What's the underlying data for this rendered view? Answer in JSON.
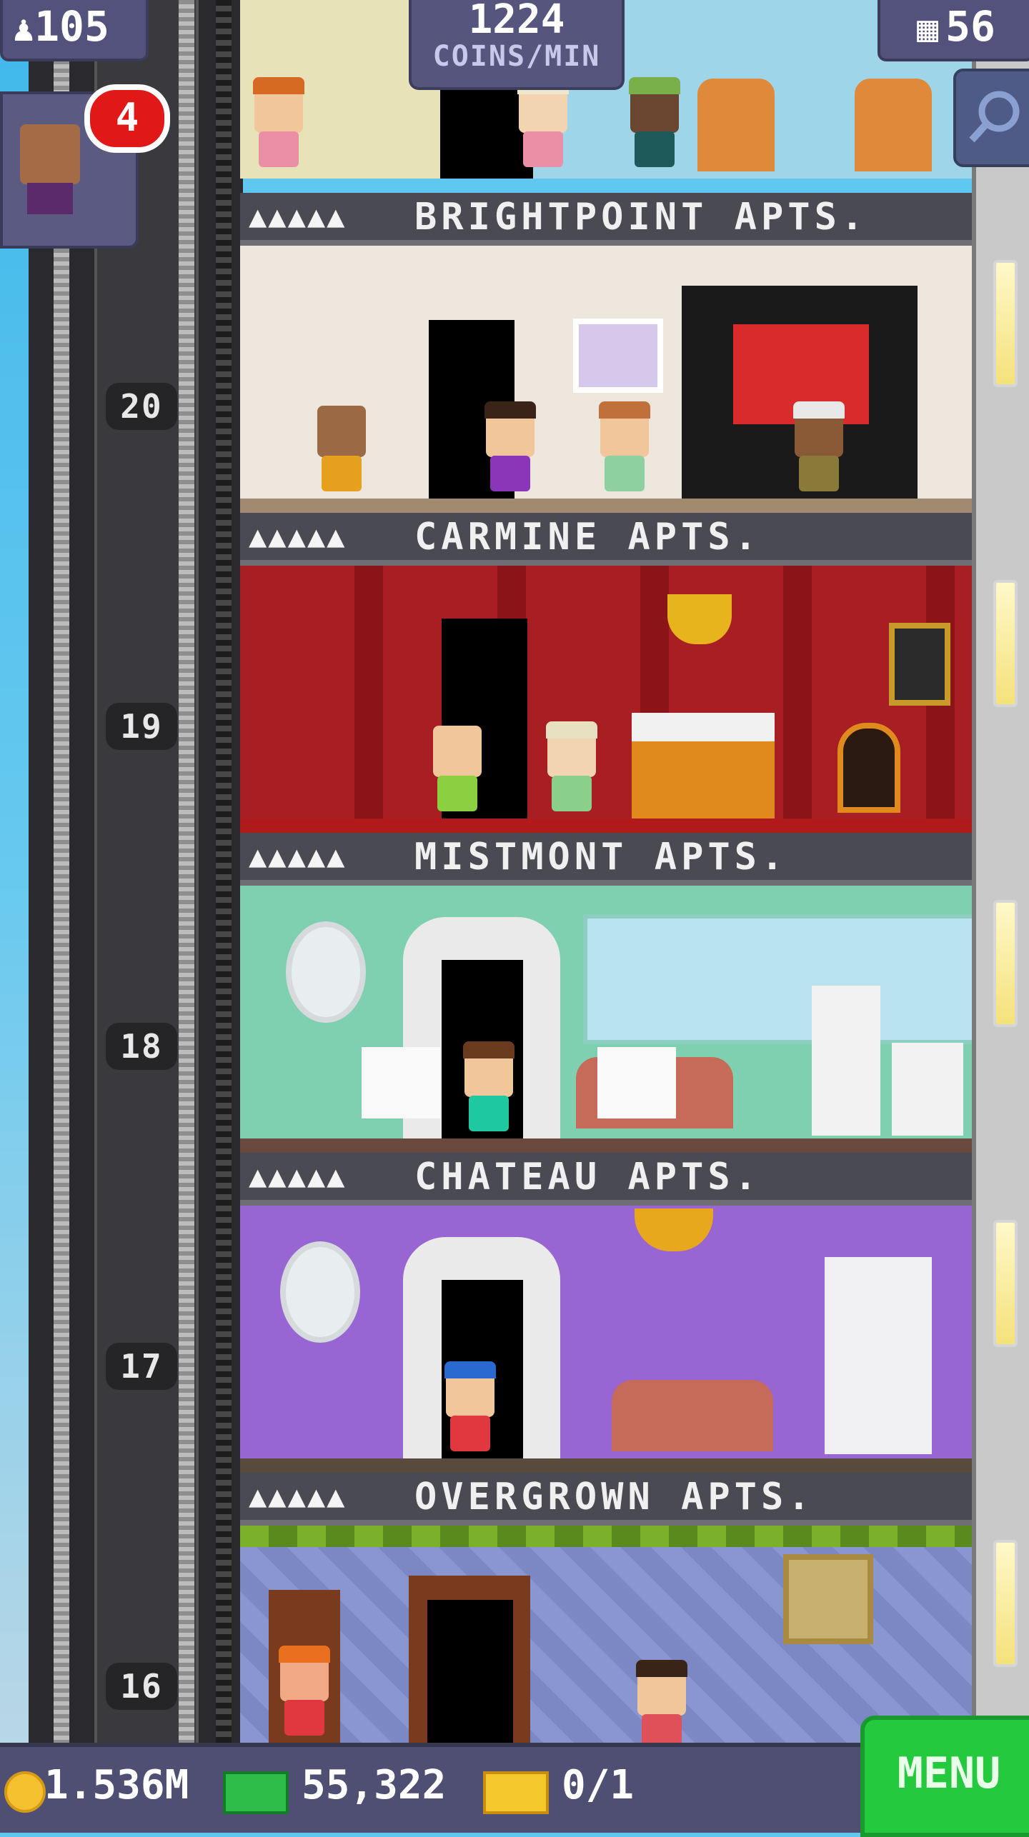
{
  "hud": {
    "population": "105",
    "coin_rate_value": "1224",
    "coin_rate_unit": "COINS/MIN",
    "floors_count": "56",
    "visitor_badge": "4"
  },
  "floors": [
    {
      "number": "20",
      "name": "BRIGHTPOINT APTS.",
      "stars": "▲▲▲▲▲"
    },
    {
      "number": "19",
      "name": "CARMINE APTS.",
      "stars": "▲▲▲▲▲"
    },
    {
      "number": "18",
      "name": "MISTMONT APTS.",
      "stars": "▲▲▲▲▲"
    },
    {
      "number": "17",
      "name": "CHATEAU APTS.",
      "stars": "▲▲▲▲▲"
    },
    {
      "number": "16",
      "name": "OVERGROWN APTS.",
      "stars": "▲▲▲▲▲"
    }
  ],
  "bottom_bar": {
    "coins": "1.536M",
    "bux": "55,322",
    "tickets": "0/1",
    "menu_label": "MENU"
  },
  "colors": {
    "hud_purple": "#52527c",
    "menu_green": "#25c93d",
    "badge_red": "#e01818"
  },
  "icons": [
    "person-icon",
    "building-icon",
    "search-icon",
    "coin-icon",
    "bux-icon",
    "ticket-icon"
  ]
}
